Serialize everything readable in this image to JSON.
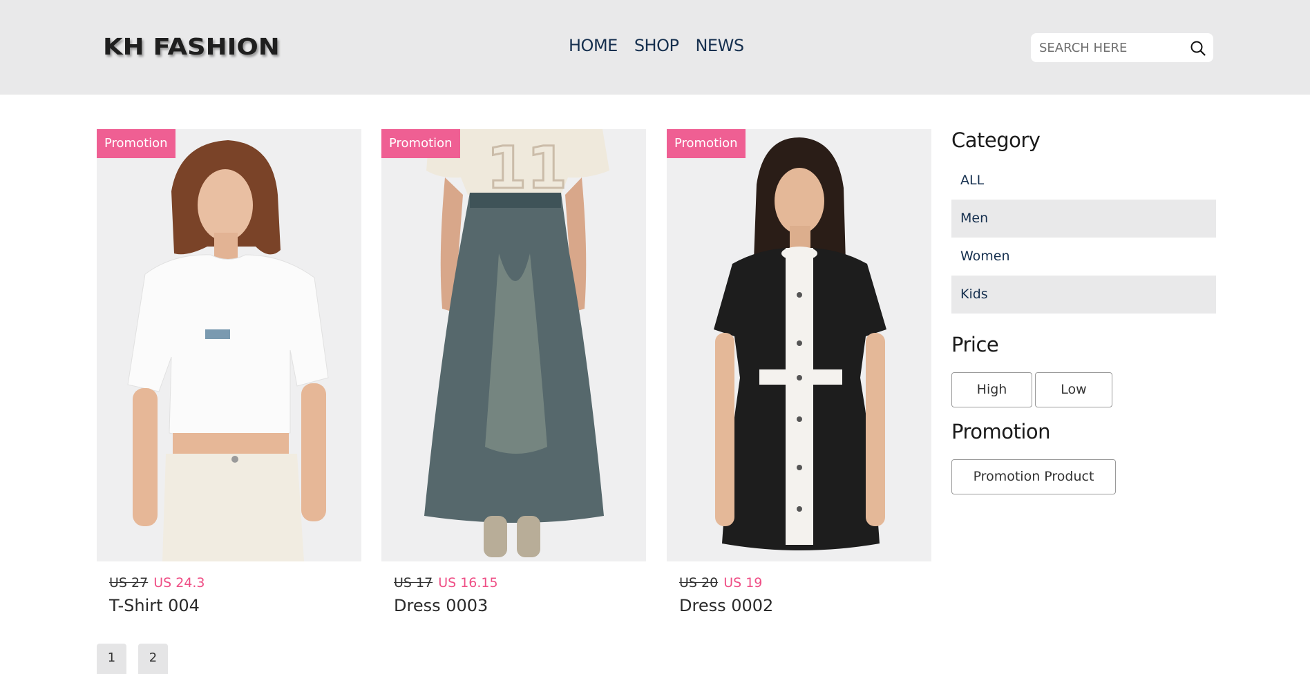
{
  "header": {
    "logo": "KH FASHION",
    "nav": [
      "HOME",
      "SHOP",
      "NEWS"
    ],
    "search_placeholder": "SEARCH HERE"
  },
  "products": [
    {
      "badge": "Promotion",
      "old_price": "US 27",
      "new_price": "US 24.3",
      "name": "T-Shirt 004",
      "image": "woman in white crop t-shirt and cream jeans"
    },
    {
      "badge": "Promotion",
      "old_price": "US 17",
      "new_price": "US 16.15",
      "name": "Dress 0003",
      "image": "long washed denim maxi skirt with jersey top"
    },
    {
      "badge": "Promotion",
      "old_price": "US 20",
      "new_price": "US 19",
      "name": "Dress 0002",
      "image": "woman in black dress with white cross panel"
    }
  ],
  "pagination": [
    "1",
    "2"
  ],
  "sidebar": {
    "category_title": "Category",
    "categories": [
      "ALL",
      "Men",
      "Women",
      "Kids"
    ],
    "price_title": "Price",
    "price_buttons": [
      "High",
      "Low"
    ],
    "promotion_title": "Promotion",
    "promotion_button": "Promotion Product"
  },
  "colors": {
    "header_bg": "#e9e9ea",
    "nav_text": "#16304f",
    "badge_bg": "#ef5f93",
    "sale_price": "#ef4f86"
  }
}
